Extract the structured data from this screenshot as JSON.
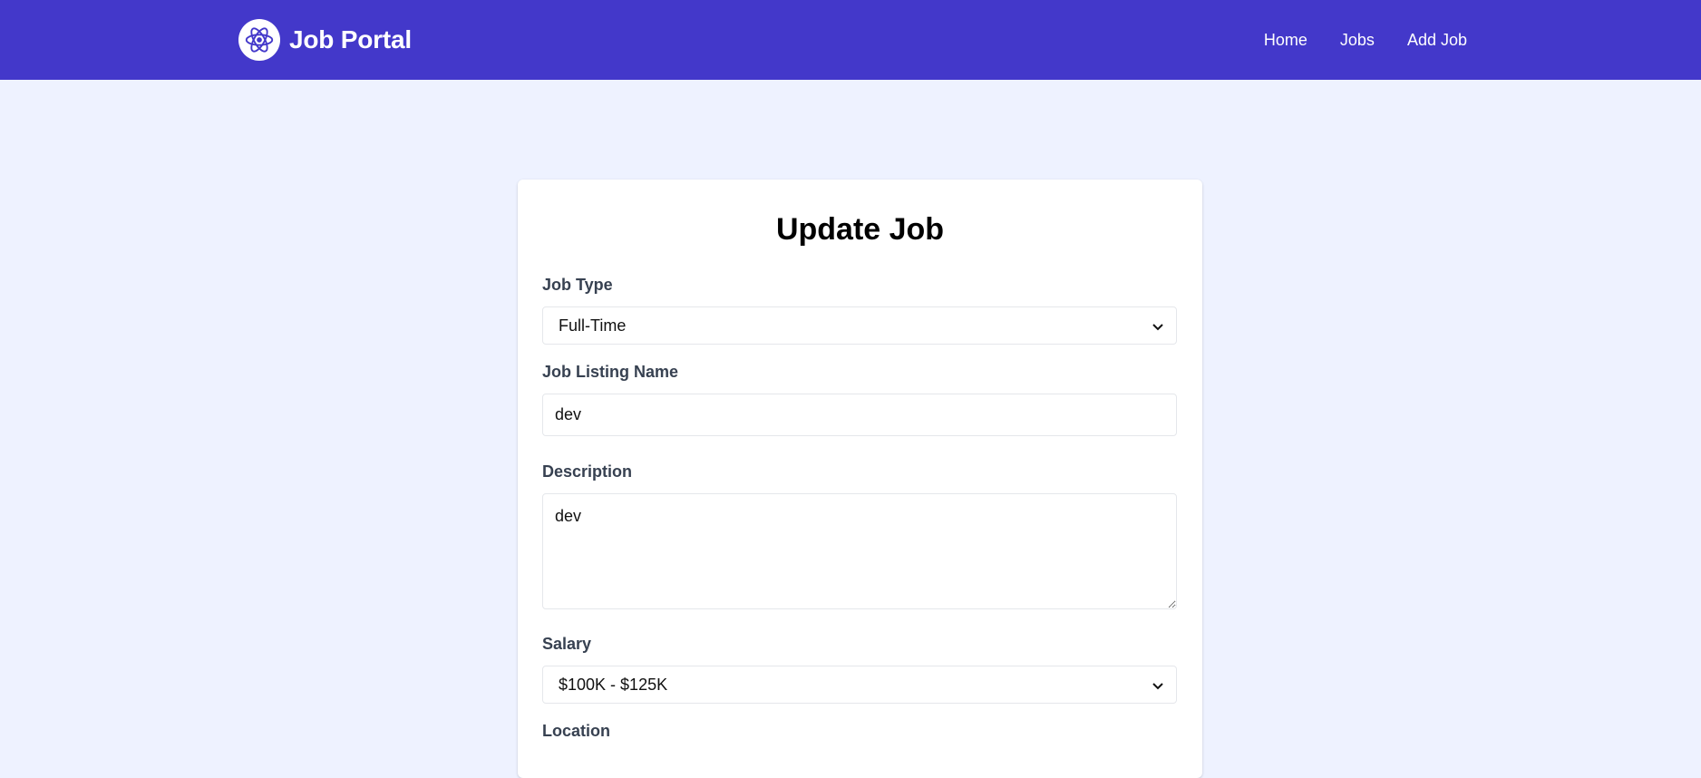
{
  "header": {
    "brand_title": "Job Portal",
    "logo_icon": "react-atom-icon",
    "nav": [
      {
        "label": "Home"
      },
      {
        "label": "Jobs"
      },
      {
        "label": "Add Job"
      }
    ],
    "colors": {
      "navbar": "#4338ca",
      "page_bg": "#eef2ff"
    }
  },
  "form": {
    "title": "Update Job",
    "job_type": {
      "label": "Job Type",
      "value": "Full-Time"
    },
    "job_listing_name": {
      "label": "Job Listing Name",
      "value": "dev"
    },
    "description": {
      "label": "Description",
      "value": "dev"
    },
    "salary": {
      "label": "Salary",
      "value": "$100K - $125K"
    },
    "location": {
      "label": "Location"
    }
  }
}
